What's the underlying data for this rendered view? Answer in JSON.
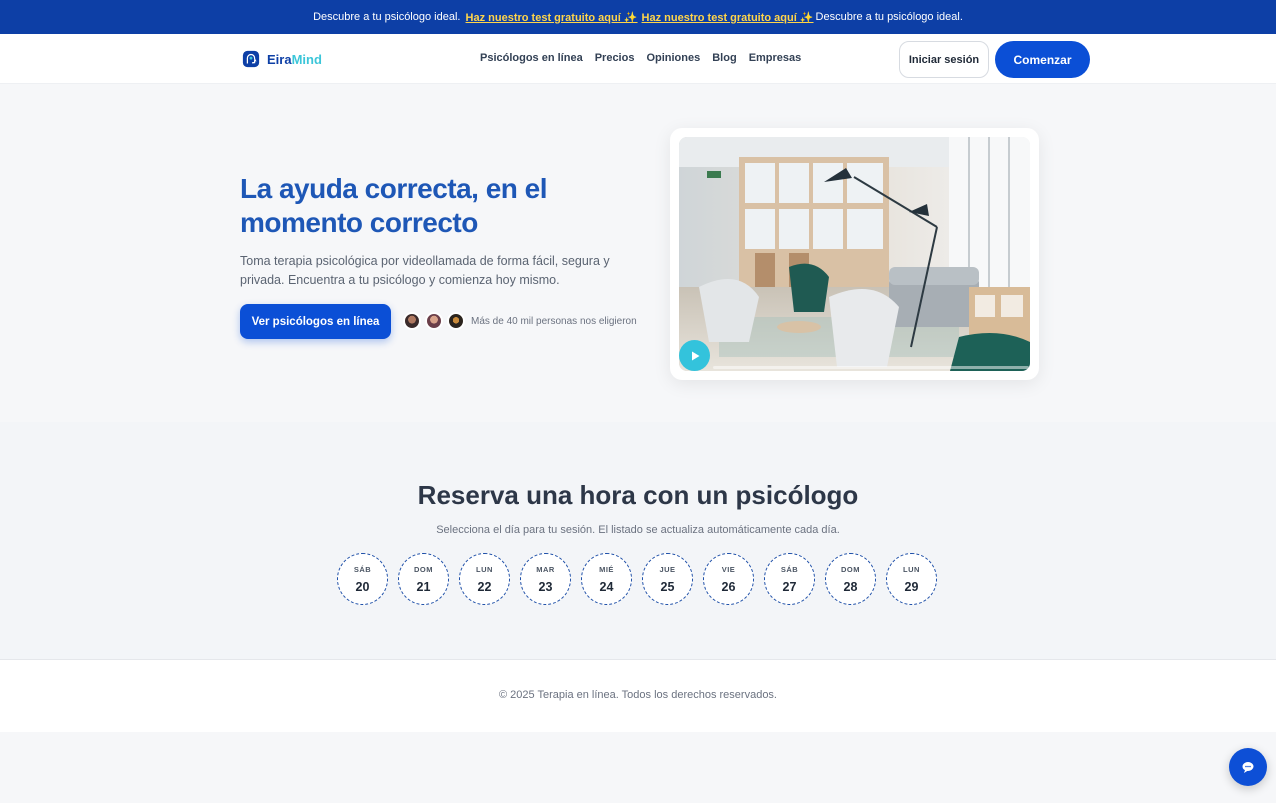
{
  "topbar": {
    "lead": "Descubre a tu psicólogo ideal.",
    "link1": "Haz nuestro test gratuito aquí ✨",
    "link2": "Haz nuestro test gratuito aquí ✨",
    "trail": "Descubre a tu psicólogo ideal."
  },
  "header": {
    "logo_part1": "Eira",
    "logo_part2": "Mind",
    "nav": [
      "Psicólogos en línea",
      "Precios",
      "Opiniones",
      "Blog",
      "Empresas"
    ],
    "login_label": "Iniciar sesión",
    "start_label": "Comenzar"
  },
  "hero": {
    "title": "La ayuda correcta, en el momento correcto",
    "subtitle": "Toma terapia psicológica por videollamada de forma fácil, segura y privada. Encuentra a tu psicólogo y comienza hoy mismo.",
    "cta_label": "Ver psicólogos en línea",
    "social_proof": "Más de 40 mil personas nos eligieron",
    "video_progress": 0
  },
  "booking": {
    "title": "Reserva una hora con un psicólogo",
    "subtitle": "Selecciona el día para tu sesión. El listado se actualiza automáticamente cada día.",
    "days": [
      {
        "dow": "SÁB",
        "num": "20"
      },
      {
        "dow": "DOM",
        "num": "21"
      },
      {
        "dow": "LUN",
        "num": "22"
      },
      {
        "dow": "MAR",
        "num": "23"
      },
      {
        "dow": "MIÉ",
        "num": "24"
      },
      {
        "dow": "JUE",
        "num": "25"
      },
      {
        "dow": "VIE",
        "num": "26"
      },
      {
        "dow": "SÁB",
        "num": "27"
      },
      {
        "dow": "DOM",
        "num": "28"
      },
      {
        "dow": "LUN",
        "num": "29"
      }
    ]
  },
  "footer": {
    "copyright": "© 2025 Terapia en línea. Todos los derechos reservados."
  },
  "colors": {
    "brand_dark": "#0d3fa6",
    "brand_primary": "#0b4fd6",
    "brand_accent": "#3cc6d9",
    "title_blue": "#1e57b6"
  },
  "icons": {
    "logo": "head-logo-icon",
    "play": "play-icon",
    "chat": "chat-bubble-icon"
  }
}
